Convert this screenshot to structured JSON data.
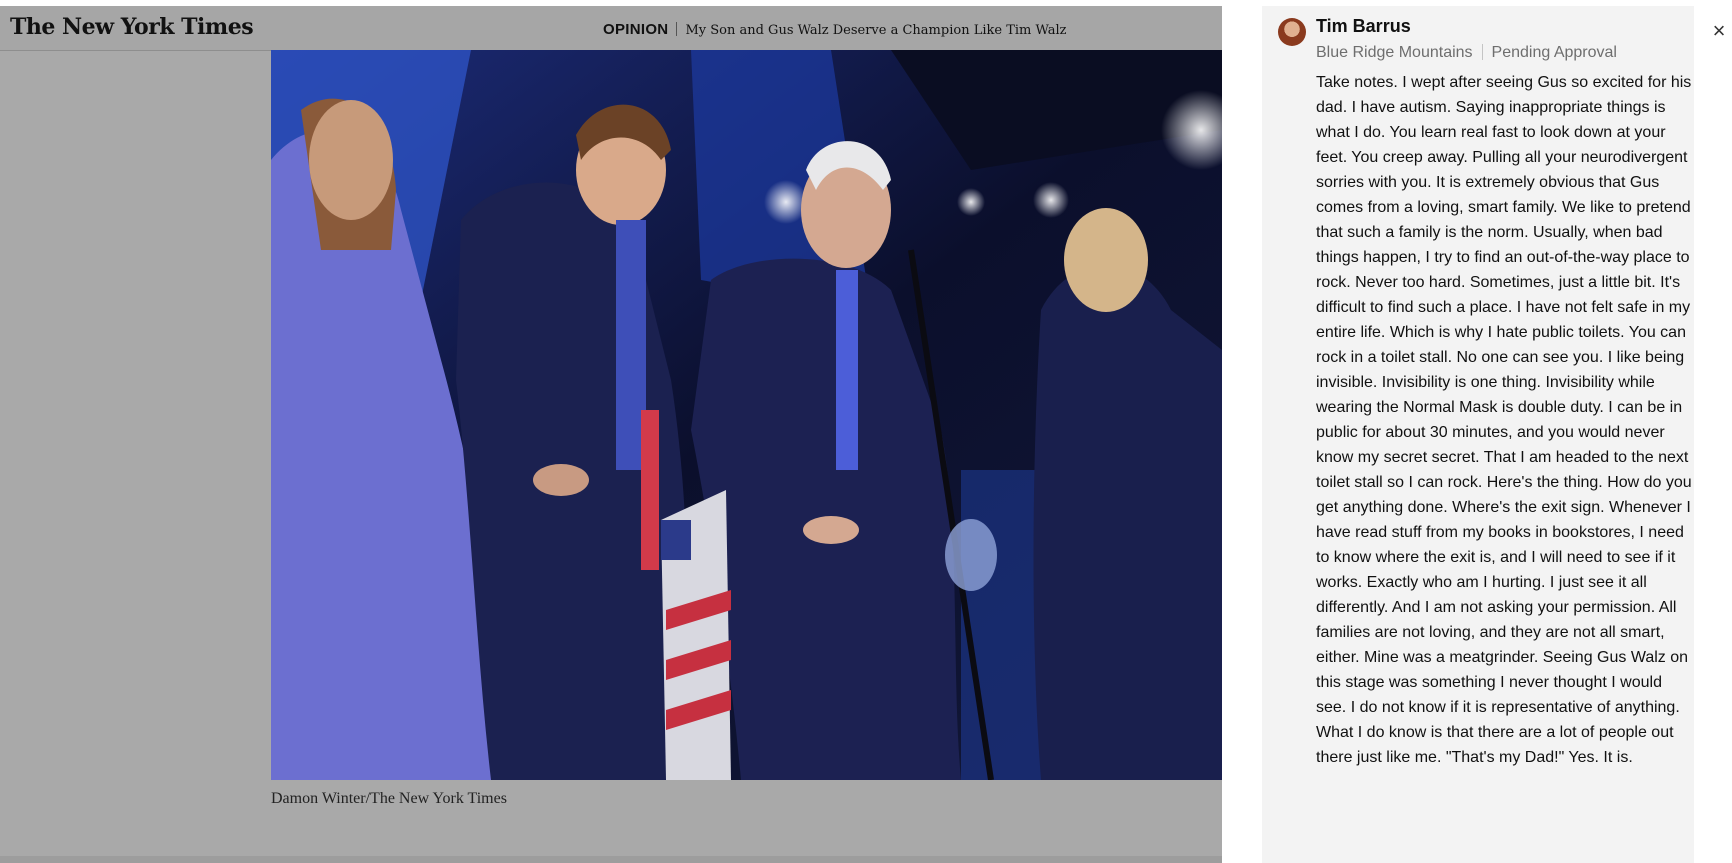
{
  "header": {
    "logo": "The New York Times",
    "section": "OPINION",
    "article_title": "My Son and Gus Walz Deserve a Champion Like Tim Walz"
  },
  "photo": {
    "caption": "Damon Winter/The New York Times"
  },
  "comment": {
    "author": "Tim Barrus",
    "location": "Blue Ridge Mountains",
    "status": "Pending Approval",
    "body": "Take notes. I wept after seeing Gus so excited for his dad. I have autism. Saying inappropriate things is what I do. You learn real fast to look down at your feet. You creep away. Pulling all your neurodivergent sorries with you. It is extremely obvious that Gus comes from a loving, smart family. We like to pretend that such a family is the norm. Usually, when bad things happen, I try to find an out-of-the-way place to rock. Never too hard. Sometimes, just a little bit. It's difficult to find such a place. I have not felt safe in my entire life. Which is why I hate public toilets. You can rock in a toilet stall. No one can see you. I like being invisible. Invisibility is one thing. Invisibility while wearing the Normal Mask is double duty. I can be in public for about 30 minutes, and you would never know my secret secret. That I am headed to the next toilet stall so I can rock. Here's the thing. How do you get anything done. Where's the exit sign. Whenever I have read stuff from my books in bookstores, I need to know where the exit is, and I will need to see if it works. Exactly who am I hurting. I just see it all differently. And I am not asking your permission. All families are not loving, and they are not all smart, either. Mine was a meatgrinder. Seeing Gus Walz on this stage was something I never thought I would see. I do not know if it is representative of anything. What I do know is that there are a lot of people out there just like me. \"That's my Dad!\" Yes. It is."
  },
  "controls": {
    "close_icon": "close-icon",
    "close_glyph": "×"
  }
}
